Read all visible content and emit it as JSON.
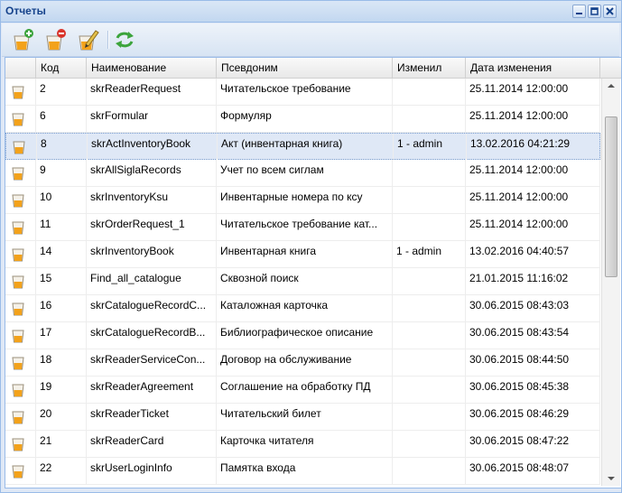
{
  "window": {
    "title": "Отчеты"
  },
  "toolbar": {
    "buttons": [
      {
        "name": "add-report",
        "icon": "add-report-icon"
      },
      {
        "name": "delete-report",
        "icon": "delete-report-icon"
      },
      {
        "name": "edit-report",
        "icon": "edit-report-icon"
      },
      {
        "name": "refresh",
        "icon": "refresh-icon"
      }
    ]
  },
  "grid": {
    "columns": [
      "",
      "Код",
      "Наименование",
      "Псевдоним",
      "Изменил",
      "Дата изменения"
    ],
    "selected_index": 2,
    "rows": [
      {
        "code": "2",
        "name": "skrReaderRequest",
        "alias": "Читательское требование",
        "changed_by": "",
        "date": "25.11.2014 12:00:00"
      },
      {
        "code": "6",
        "name": "skrFormular",
        "alias": "Формуляр",
        "changed_by": "",
        "date": "25.11.2014 12:00:00"
      },
      {
        "code": "8",
        "name": "skrActInventoryBook",
        "alias": "Акт (инвентарная книга)",
        "changed_by": "1 - admin",
        "date": "13.02.2016 04:21:29"
      },
      {
        "code": "9",
        "name": "skrAllSiglaRecords",
        "alias": "Учет по всем сиглам",
        "changed_by": "",
        "date": "25.11.2014 12:00:00"
      },
      {
        "code": "10",
        "name": "skrInventoryKsu",
        "alias": "Инвентарные номера по ксу",
        "changed_by": "",
        "date": "25.11.2014 12:00:00"
      },
      {
        "code": "11",
        "name": "skrOrderRequest_1",
        "alias": "Читательское требование кат...",
        "changed_by": "",
        "date": "25.11.2014 12:00:00"
      },
      {
        "code": "14",
        "name": "skrInventoryBook",
        "alias": "Инвентарная книга",
        "changed_by": "1 - admin",
        "date": "13.02.2016 04:40:57"
      },
      {
        "code": "15",
        "name": "Find_all_catalogue",
        "alias": "Сквозной поиск",
        "changed_by": "",
        "date": "21.01.2015 11:16:02"
      },
      {
        "code": "16",
        "name": "skrCatalogueRecordC...",
        "alias": "Каталожная карточка",
        "changed_by": "",
        "date": "30.06.2015 08:43:03"
      },
      {
        "code": "17",
        "name": "skrCatalogueRecordB...",
        "alias": "Библиографическое описание",
        "changed_by": "",
        "date": "30.06.2015 08:43:54"
      },
      {
        "code": "18",
        "name": "skrReaderServiceCon...",
        "alias": "Договор на обслуживание",
        "changed_by": "",
        "date": "30.06.2015 08:44:50"
      },
      {
        "code": "19",
        "name": "skrReaderAgreement",
        "alias": "Соглашение на обработку ПД",
        "changed_by": "",
        "date": "30.06.2015 08:45:38"
      },
      {
        "code": "20",
        "name": "skrReaderTicket",
        "alias": "Читательский билет",
        "changed_by": "",
        "date": "30.06.2015 08:46:29"
      },
      {
        "code": "21",
        "name": "skrReaderCard",
        "alias": "Карточка читателя",
        "changed_by": "",
        "date": "30.06.2015 08:47:22"
      },
      {
        "code": "22",
        "name": "skrUserLoginInfo",
        "alias": "Памятка входа",
        "changed_by": "",
        "date": "30.06.2015 08:48:07"
      }
    ]
  }
}
